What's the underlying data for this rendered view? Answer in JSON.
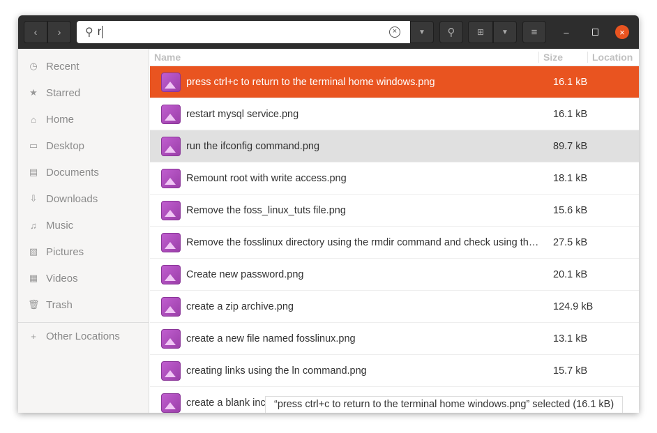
{
  "search": {
    "value": "r"
  },
  "sidebar": {
    "items": [
      {
        "label": "Recent",
        "icon": "clock-icon",
        "glyph": "◷"
      },
      {
        "label": "Starred",
        "icon": "star-icon",
        "glyph": "★"
      },
      {
        "label": "Home",
        "icon": "home-icon",
        "glyph": "⌂"
      },
      {
        "label": "Desktop",
        "icon": "desktop-icon",
        "glyph": "▭"
      },
      {
        "label": "Documents",
        "icon": "document-icon",
        "glyph": "▤"
      },
      {
        "label": "Downloads",
        "icon": "download-icon",
        "glyph": "⇩"
      },
      {
        "label": "Music",
        "icon": "music-icon",
        "glyph": "♫"
      },
      {
        "label": "Pictures",
        "icon": "picture-icon",
        "glyph": "▨"
      },
      {
        "label": "Videos",
        "icon": "video-icon",
        "glyph": "▦"
      },
      {
        "label": "Trash",
        "icon": "trash-icon",
        "glyph": "🗑"
      }
    ],
    "other": {
      "label": "Other Locations",
      "glyph": "+"
    }
  },
  "columns": {
    "name": "Name",
    "size": "Size",
    "location": "Location"
  },
  "files": [
    {
      "name": "press ctrl+c to return to the terminal home windows.png",
      "size": "16.1 kB"
    },
    {
      "name": "restart mysql service.png",
      "size": "16.1 kB"
    },
    {
      "name": "run the ifconfig command.png",
      "size": "89.7 kB"
    },
    {
      "name": "Remount root with write access.png",
      "size": "18.1 kB"
    },
    {
      "name": "Remove the foss_linux_tuts file.png",
      "size": "15.6 kB"
    },
    {
      "name": "Remove the fosslinux directory using the rmdir command and check using the ls command.png",
      "size": "27.5 kB"
    },
    {
      "name": "Create new password.png",
      "size": "20.1 kB"
    },
    {
      "name": "create a zip archive.png",
      "size": "124.9 kB"
    },
    {
      "name": "create a new file named fosslinux.png",
      "size": "13.1 kB"
    },
    {
      "name": "creating links using the ln command.png",
      "size": "15.7 kB"
    },
    {
      "name": "create a blank inc",
      "size": ""
    }
  ],
  "status": "“press ctrl+c to return to the terminal home windows.png” selected  (16.1 kB)",
  "accent": "#e95420"
}
